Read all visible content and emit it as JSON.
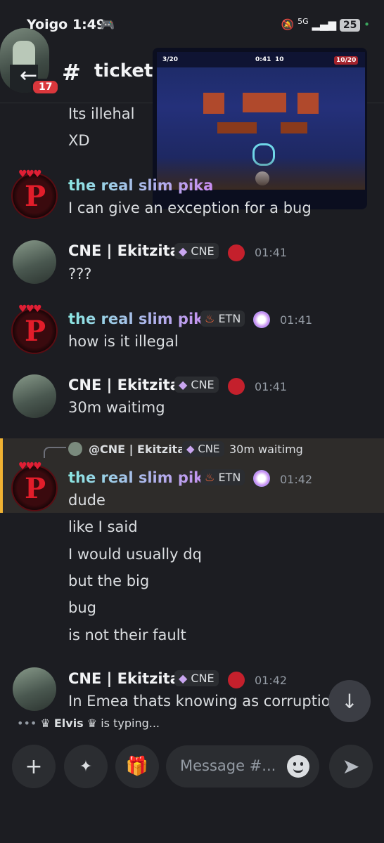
{
  "status_bar": {
    "carrier_time": "Yoigo 1:49",
    "network": "5G",
    "battery": "25"
  },
  "header": {
    "channel_name": "ticket-",
    "unread_count": "17"
  },
  "game_overlay": {
    "left_count": "3/20",
    "timer": "0:41",
    "mid_count": "10",
    "right_count": "10/20"
  },
  "messages": [
    {
      "text": "Its illehal"
    },
    {
      "text": "XD"
    },
    {
      "username": "the real slim pika",
      "text": "I can give an exception for a bug"
    },
    {
      "username": "CNE | Ekitzita",
      "tag": "CNE",
      "time": "01:41",
      "text": "???"
    },
    {
      "username": "the real slim pika",
      "tag": "ETN",
      "time": "01:41",
      "text": "how is it illegal"
    },
    {
      "username": "CNE | Ekitzita",
      "tag": "CNE",
      "time": "01:41",
      "text": "30m waitimg"
    },
    {
      "reply": {
        "username": "@CNE | Ekitzita",
        "tag": "CNE",
        "text": "30m waitimg"
      },
      "username": "the real slim pika",
      "tag": "ETN",
      "time": "01:42",
      "lines": [
        "dude",
        "like I said",
        "I would usually dq",
        "but the big",
        "bug",
        "is not their fault"
      ]
    },
    {
      "username": "CNE | Ekitzita",
      "tag": "CNE",
      "time": "01:42",
      "text": "In Emea thats knowing as corruption"
    }
  ],
  "typing": {
    "user": "Elvis",
    "suffix": "is typing..."
  },
  "composer": {
    "placeholder": "Message #..."
  },
  "colors": {
    "background": "#1c1d22",
    "reply_accent": "#f0b232",
    "pika_red": "#e21d2a"
  }
}
